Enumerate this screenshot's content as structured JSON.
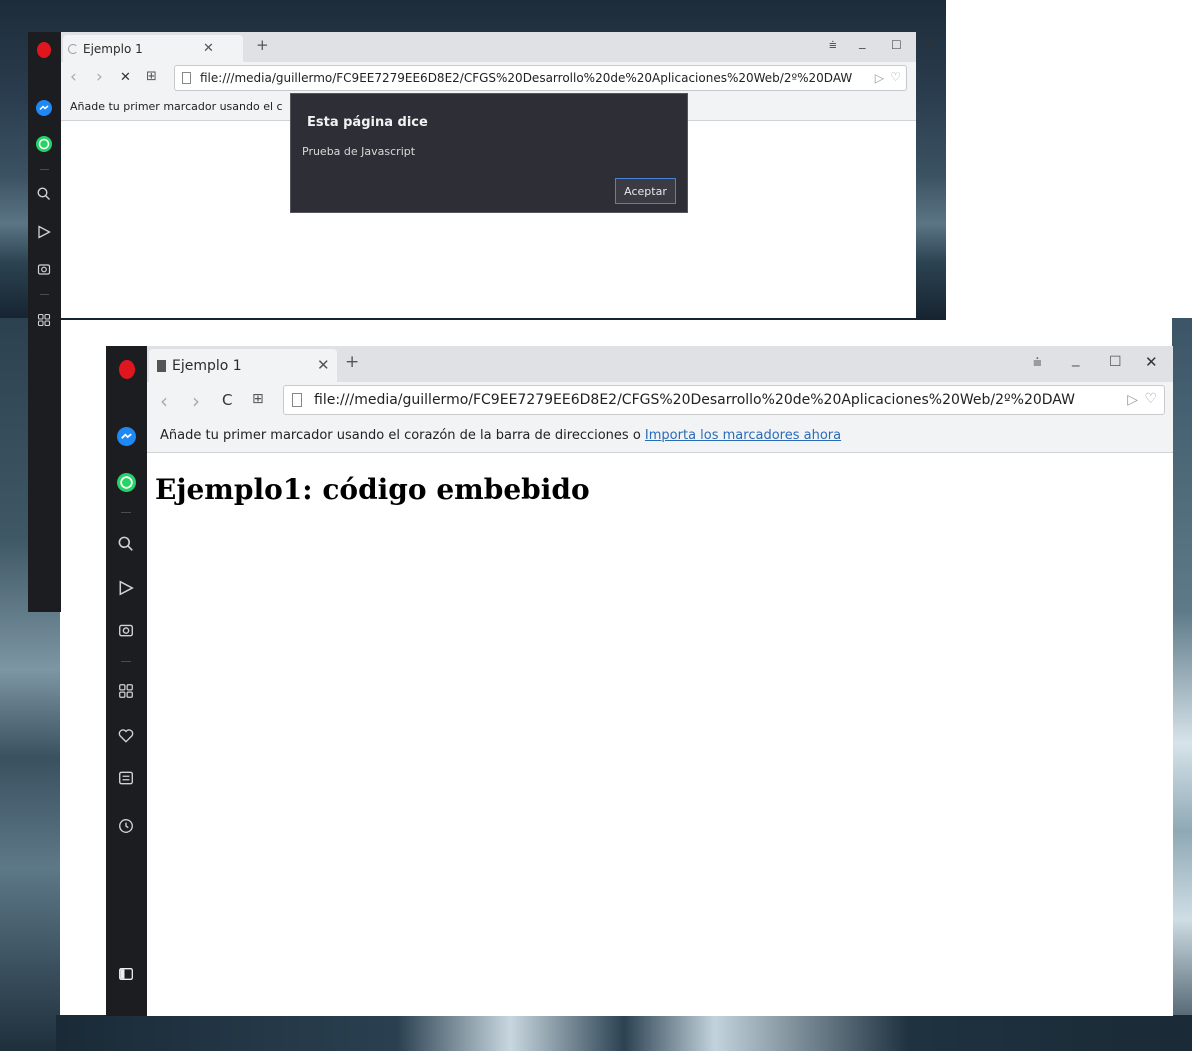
{
  "back_window": {
    "tab": {
      "title": "Ejemplo 1"
    },
    "nav": {
      "back": "‹",
      "forward": "›",
      "stop": "✕",
      "grid": "⊞"
    },
    "address": {
      "url": "file:///media/guillermo/FC9EE7279EE6D8E2/CFGS%20Desarrollo%20de%20Aplicaciones%20Web/2º%20DAW"
    },
    "bookmarks_bar": {
      "text": "Añade tu primer marcador usando el c"
    },
    "window_controls": {
      "menu": "⩧",
      "minimize": "_",
      "maximize": "☐",
      "close": "✕"
    }
  },
  "dialog": {
    "title": "Esta página dice",
    "message": "Prueba de Javascript",
    "accept_label": "Aceptar"
  },
  "front_window": {
    "tab": {
      "title": "Ejemplo 1"
    },
    "nav": {
      "back": "‹",
      "forward": "›",
      "reload": "C",
      "grid": "⊞"
    },
    "address": {
      "url": "file:///media/guillermo/FC9EE7279EE6D8E2/CFGS%20Desarrollo%20de%20Aplicaciones%20Web/2º%20DAW"
    },
    "bookmarks_bar": {
      "text": "Añade tu primer marcador usando el corazón de la barra de direcciones o",
      "link": "Importa los marcadores ahora"
    },
    "window_controls": {
      "menu": "⩧",
      "minimize": "_",
      "maximize": "☐",
      "close": "✕"
    },
    "page": {
      "heading": "Ejemplo1: código embebido"
    }
  },
  "colors": {
    "sidebar": "#1c1d20",
    "opera_red": "#e0161f",
    "messenger_blue": "#1e88f5",
    "whatsapp_green": "#25d366",
    "link": "#2a6bb7",
    "dialog_bg": "#2e2f36",
    "dialog_button_border": "#4a82d6"
  }
}
